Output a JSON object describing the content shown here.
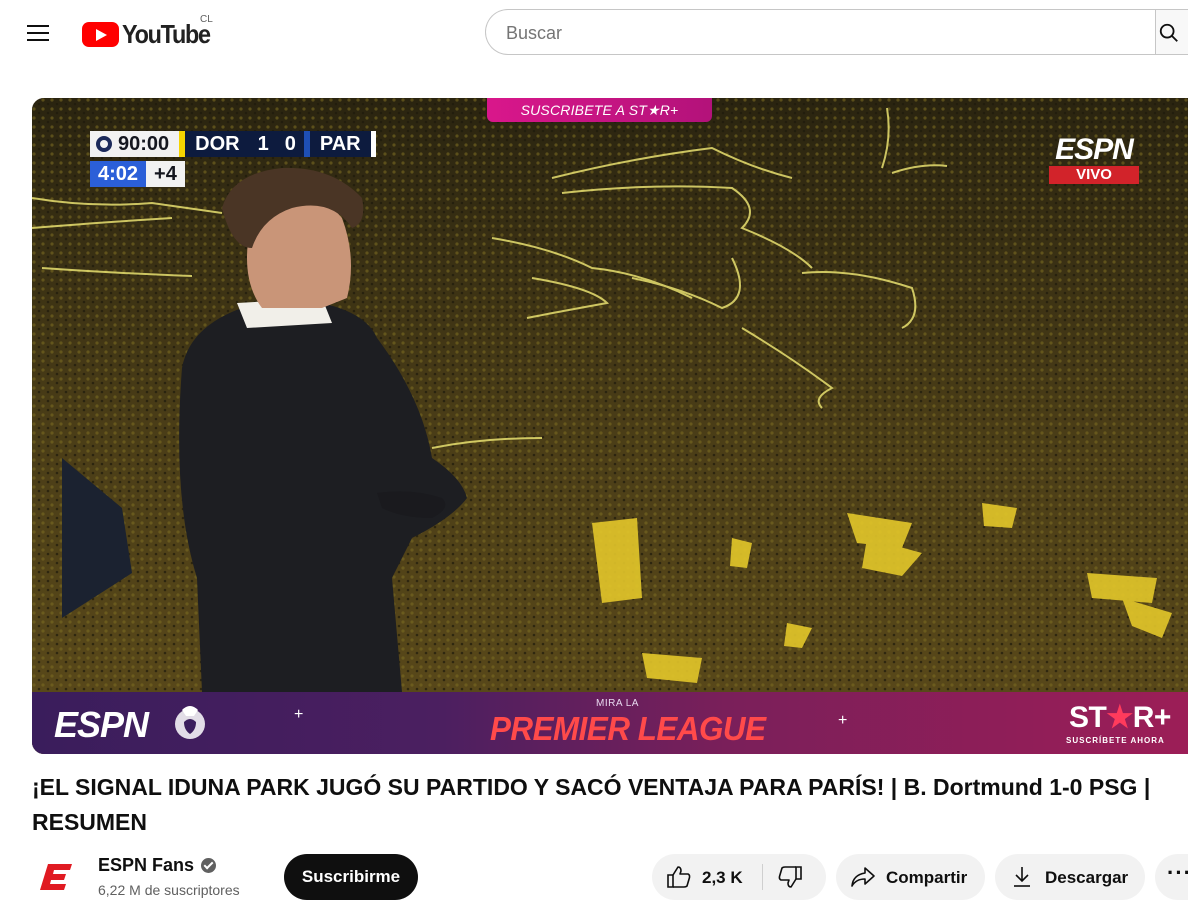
{
  "header": {
    "logo_text": "YouTube",
    "country_code": "CL",
    "search_placeholder": "Buscar"
  },
  "video": {
    "banner_top": "SUSCRIBETE A ST★R+",
    "scorebug": {
      "match_time": "90:00",
      "home_team": "DOR",
      "home_score": "1",
      "away_score": "0",
      "away_team": "PAR",
      "stoppage_clock": "4:02",
      "added_time": "+4"
    },
    "broadcaster": "ESPN",
    "live_label": "VIVO",
    "bottom_banner": {
      "left_logo": "ESPN",
      "pre_title": "MIRA LA",
      "title": "PREMIER LEAGUE",
      "right_logo_left": "ST",
      "right_logo_star": "★",
      "right_logo_right": "R+",
      "right_tagline": "SUSCRÍBETE AHORA"
    }
  },
  "title": "¡EL SIGNAL IDUNA PARK JUGÓ SU PARTIDO Y SACÓ VENTAJA PARA PARÍS! | B. Dortmund 1-0 PSG | RESUMEN",
  "channel": {
    "name": "ESPN Fans",
    "subscribers": "6,22 M de suscriptores",
    "subscribe_label": "Suscribirme"
  },
  "actions": {
    "like_count": "2,3 K",
    "share_label": "Compartir",
    "download_label": "Descargar",
    "more_label": "···"
  },
  "colors": {
    "brand_red": "#ff0000",
    "subscribe_bg": "#0f0f0f",
    "pill_bg": "#f2f2f2",
    "espn_red": "#d2232a"
  }
}
